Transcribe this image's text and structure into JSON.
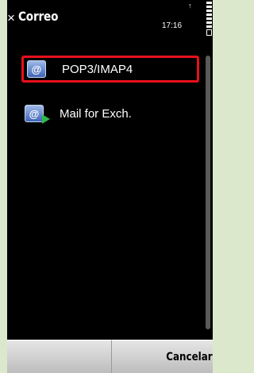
{
  "titlebar": {
    "close_glyph": "×",
    "title": "Correo",
    "time": "17:16",
    "signal_glyph": "↑"
  },
  "menu": {
    "items": [
      {
        "label": "POP3/IMAP4",
        "icon": "at-mailbox-icon",
        "selected": true
      },
      {
        "label": "Mail for Exch.",
        "icon": "mail-for-exchange-icon",
        "selected": false
      }
    ]
  },
  "softkeys": {
    "left": "",
    "right": "Cancelar"
  },
  "colors": {
    "background": "#000000",
    "selection": "#e8101c",
    "softkey_bar": "#d0d0d0"
  }
}
